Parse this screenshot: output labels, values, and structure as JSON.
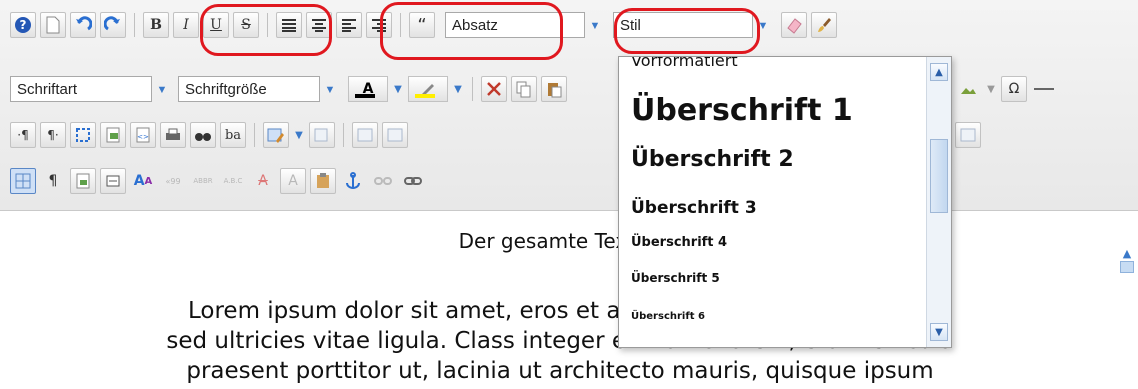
{
  "toolbar": {
    "row1": {
      "format_combo": "Absatz",
      "style_combo": "Stil",
      "bold": "B",
      "italic": "I",
      "underline": "U",
      "strike": "S",
      "quote": "“"
    },
    "row2": {
      "font_combo": "Schriftart",
      "size_combo": "Schriftgröße",
      "text_color": "A",
      "omega": "Ω"
    },
    "row3": {
      "ba": "ba"
    },
    "colors": {
      "accent": "#3a79c9",
      "callout": "#e0181f",
      "text_color_bar": "#000000",
      "highlight_bar": "#ffee00"
    }
  },
  "dropdown": {
    "options": [
      "Vorformatiert",
      "Überschrift 1",
      "Überschrift 2",
      "Überschrift 3",
      "Überschrift 4",
      "Überschrift 5",
      "Überschrift 6"
    ]
  },
  "editor": {
    "line1": "Der gesamte Text is",
    "para_line1": "Lorem ipsum dolor sit amet, eros et ali                          d tempus",
    "para_line2": "sed ultricies vitae ligula. Class integer et mattis lorem, erat vehicula",
    "para_line3": "praesent porttitor ut, lacinia ut architecto mauris, quisque ipsum"
  }
}
